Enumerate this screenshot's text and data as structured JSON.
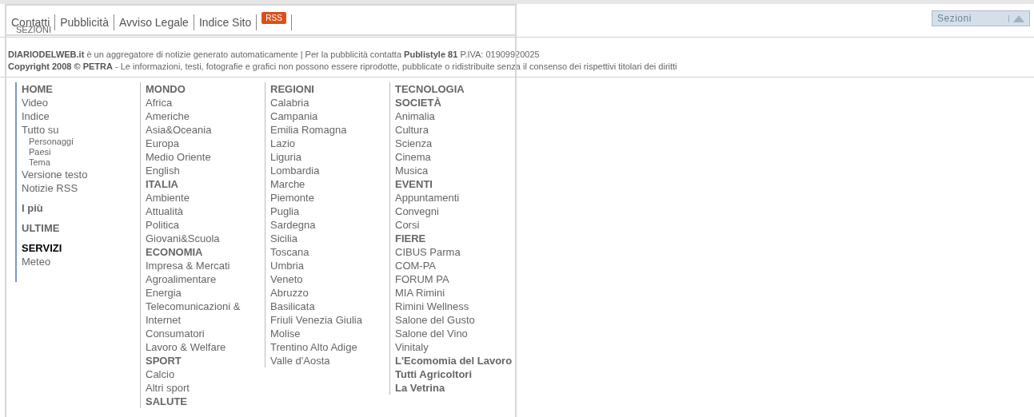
{
  "sections_dropdown": {
    "label": "Sezioni"
  },
  "footer": {
    "lines": [
      "**DIARIODELWEB.it** è un aggregatore di notizie generato automaticamente | Per la pubblicità contatta **Publistyle 81** P.IVA: 01909920025",
      "**Copyright 2008 © PETRA** - Le informazioni, testi, fotografie e grafici non possono essere riprodotte, pubblicate o ridistribuite senza il consenso dei rispettivi titolari dei diritti"
    ]
  },
  "menu": {
    "links": [
      "Contatti",
      "Pubblicità",
      "Avviso Legale",
      "Indice Sito"
    ],
    "rss_badge": "RSS",
    "caption": "SEZIONI",
    "columns": [
      {
        "items": [
          {
            "kind": "heading",
            "text": "HOME"
          },
          {
            "kind": "link",
            "text": "Video"
          },
          {
            "kind": "link",
            "text": "Indice"
          },
          {
            "kind": "link",
            "text": "Tutto su"
          },
          {
            "kind": "sublink",
            "text": "Personaggi"
          },
          {
            "kind": "sublink",
            "text": "Paesi"
          },
          {
            "kind": "sublink",
            "text": "Tema"
          },
          {
            "kind": "link",
            "text": "Versione testo"
          },
          {
            "kind": "link",
            "text": "Notizie RSS"
          },
          {
            "kind": "group",
            "text": "I più"
          },
          {
            "kind": "group",
            "text": "ULTIME"
          },
          {
            "kind": "current",
            "text": "SERVIZI"
          },
          {
            "kind": "link",
            "text": "Meteo"
          }
        ]
      },
      {
        "items": [
          {
            "kind": "heading",
            "text": "MONDO"
          },
          {
            "kind": "link",
            "text": "Africa"
          },
          {
            "kind": "link",
            "text": "Americhe"
          },
          {
            "kind": "link",
            "text": "Asia&Oceania"
          },
          {
            "kind": "link",
            "text": "Europa"
          },
          {
            "kind": "link",
            "text": "Medio Oriente"
          },
          {
            "kind": "link",
            "text": "English"
          },
          {
            "kind": "heading",
            "text": "ITALIA"
          },
          {
            "kind": "link",
            "text": "Ambiente"
          },
          {
            "kind": "link",
            "text": "Attualità"
          },
          {
            "kind": "link",
            "text": "Politica"
          },
          {
            "kind": "link",
            "text": "Giovani&Scuola"
          },
          {
            "kind": "heading",
            "text": "ECONOMIA"
          },
          {
            "kind": "link",
            "text": "Impresa & Mercati"
          },
          {
            "kind": "link",
            "text": "Agroalimentare"
          },
          {
            "kind": "link",
            "text": "Energia"
          },
          {
            "kind": "link",
            "text": "Telecomunicazioni & Internet"
          },
          {
            "kind": "link",
            "text": "Consumatori"
          },
          {
            "kind": "link",
            "text": "Lavoro & Welfare"
          },
          {
            "kind": "heading",
            "text": "SPORT"
          },
          {
            "kind": "link",
            "text": "Calcio"
          },
          {
            "kind": "link",
            "text": "Altri sport"
          },
          {
            "kind": "heading",
            "text": "SALUTE"
          }
        ]
      },
      {
        "items": [
          {
            "kind": "heading",
            "text": "REGIONI"
          },
          {
            "kind": "link",
            "text": "Calabria"
          },
          {
            "kind": "link",
            "text": "Campania"
          },
          {
            "kind": "link",
            "text": "Emilia Romagna"
          },
          {
            "kind": "link",
            "text": "Lazio"
          },
          {
            "kind": "link",
            "text": "Liguria"
          },
          {
            "kind": "link",
            "text": "Lombardia"
          },
          {
            "kind": "link",
            "text": "Marche"
          },
          {
            "kind": "link",
            "text": "Piemonte"
          },
          {
            "kind": "link",
            "text": "Puglia"
          },
          {
            "kind": "link",
            "text": "Sardegna"
          },
          {
            "kind": "link",
            "text": "Sicilia"
          },
          {
            "kind": "link",
            "text": "Toscana"
          },
          {
            "kind": "link",
            "text": "Umbria"
          },
          {
            "kind": "link",
            "text": "Veneto"
          },
          {
            "kind": "link",
            "text": "Abruzzo"
          },
          {
            "kind": "link",
            "text": "Basilicata"
          },
          {
            "kind": "link",
            "text": "Friuli Venezia Giulia"
          },
          {
            "kind": "link",
            "text": "Molise"
          },
          {
            "kind": "link",
            "text": "Trentino Alto Adige"
          },
          {
            "kind": "link",
            "text": "Valle d'Aosta"
          }
        ]
      },
      {
        "items": [
          {
            "kind": "heading",
            "text": "TECNOLOGIA"
          },
          {
            "kind": "heading",
            "text": "SOCIETÀ"
          },
          {
            "kind": "link",
            "text": "Animalia"
          },
          {
            "kind": "link",
            "text": "Cultura"
          },
          {
            "kind": "link",
            "text": "Scienza"
          },
          {
            "kind": "link",
            "text": "Cinema"
          },
          {
            "kind": "link",
            "text": "Musica"
          },
          {
            "kind": "heading",
            "text": "EVENTI"
          },
          {
            "kind": "link",
            "text": "Appuntamenti"
          },
          {
            "kind": "link",
            "text": "Convegni"
          },
          {
            "kind": "link",
            "text": "Corsi"
          },
          {
            "kind": "heading",
            "text": "FIERE"
          },
          {
            "kind": "link",
            "text": "CIBUS Parma"
          },
          {
            "kind": "link",
            "text": "COM-PA"
          },
          {
            "kind": "link",
            "text": "FORUM PA"
          },
          {
            "kind": "link",
            "text": "MIA Rimini"
          },
          {
            "kind": "link",
            "text": "Rimini Wellness"
          },
          {
            "kind": "link",
            "text": "Salone del Gusto"
          },
          {
            "kind": "link",
            "text": "Salone del Vino"
          },
          {
            "kind": "link",
            "text": "Vinitaly"
          },
          {
            "kind": "heading",
            "text": "L'Ecomomia del Lavoro"
          },
          {
            "kind": "heading",
            "text": "Tutti Agricoltori"
          },
          {
            "kind": "heading",
            "text": "La Vetrina"
          }
        ]
      }
    ]
  }
}
